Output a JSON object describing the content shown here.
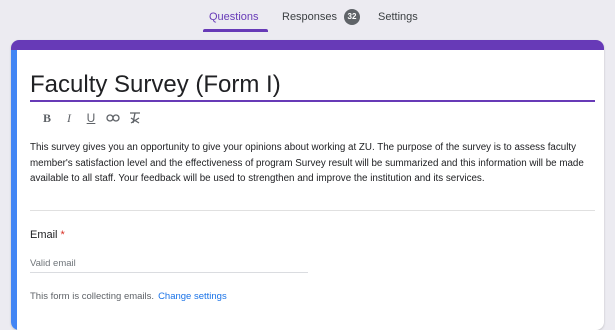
{
  "tabs": {
    "questions": "Questions",
    "responses": "Responses",
    "responses_count": "32",
    "settings": "Settings"
  },
  "form": {
    "title": "Faculty Survey (Form I)",
    "description": "This survey gives you an opportunity to give your opinions about working at ZU. The purpose of the survey is to assess faculty member's satisfaction level and the effectiveness of program Survey result will be summarized and this information will be made available to all staff. Your feedback will be used to strengthen and improve the institution and its services."
  },
  "toolbar": {
    "bold": "B",
    "italic": "I",
    "underline": "U",
    "link": "⊂⊃",
    "clear_format": "⨯"
  },
  "email_field": {
    "label": "Email",
    "required_marker": "*",
    "placeholder": "Valid email"
  },
  "collection_note": {
    "text": "This form is collecting emails.",
    "link": "Change settings"
  },
  "colors": {
    "accent": "#673ab7",
    "side_bar": "#4285f4",
    "link": "#1a73e8",
    "required": "#d93025"
  }
}
